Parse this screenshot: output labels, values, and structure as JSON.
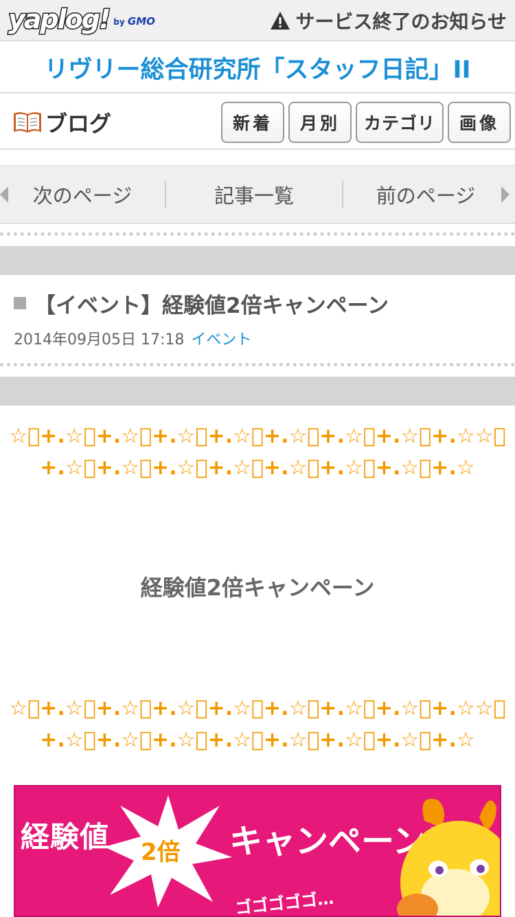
{
  "header": {
    "logo_main": "yaplog!",
    "logo_by": "by",
    "logo_brand": "GMO",
    "notice_icon": "warning-icon",
    "notice_label": "サービス終了のお知らせ"
  },
  "site": {
    "title": "リヴリー総合研究所「スタッフ日記」II"
  },
  "blog_nav": {
    "label": "ブログ",
    "icon": "book-icon",
    "buttons": [
      "新着",
      "月別",
      "カテゴリ",
      "画像"
    ]
  },
  "pager": {
    "next": "次のページ",
    "list": "記事一覧",
    "prev": "前のページ"
  },
  "post": {
    "title": "【イベント】経験値2倍キャンペーン",
    "date": "2014年09月05日 17:18",
    "category": "イベント",
    "stars_line1": "☆ﾟ+.☆ﾟ+.☆ﾟ+.☆ﾟ+.☆ﾟ+.☆ﾟ+.☆ﾟ+.☆ﾟ+.☆☆ﾟ",
    "stars_line2": "+.☆ﾟ+.☆ﾟ+.☆ﾟ+.☆ﾟ+.☆ﾟ+.☆ﾟ+.☆ﾟ+.☆",
    "heading": "経験値2倍キャンペーン"
  },
  "banner": {
    "left_text": "経験値",
    "burst_text": "2倍",
    "right_text": "キャンペーン！！",
    "sub_text": "ゴゴゴゴゴ…",
    "bg_color": "#e6197a",
    "accent_color": "#f39800"
  },
  "colors": {
    "link": "#1a8fd6",
    "stars": "#f39800"
  }
}
